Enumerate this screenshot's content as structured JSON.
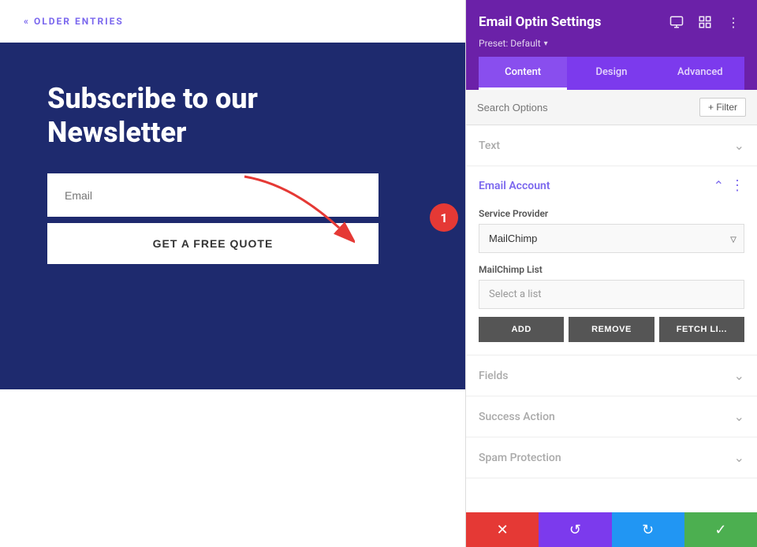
{
  "main": {
    "older_entries_label": "« Older Entries",
    "newsletter_title_line1": "Subscribe to our",
    "newsletter_title_line2": "Newsletter",
    "email_placeholder": "Email",
    "submit_button_label": "Get a free quote"
  },
  "panel": {
    "title": "Email Optin Settings",
    "preset_label": "Preset: Default",
    "tabs": [
      {
        "id": "content",
        "label": "Content",
        "active": true
      },
      {
        "id": "design",
        "label": "Design",
        "active": false
      },
      {
        "id": "advanced",
        "label": "Advanced",
        "active": false
      }
    ],
    "search_placeholder": "Search Options",
    "filter_label": "+ Filter",
    "sections": [
      {
        "id": "text",
        "label": "Text",
        "expanded": false
      },
      {
        "id": "email-account",
        "label": "Email Account",
        "expanded": true
      },
      {
        "id": "fields",
        "label": "Fields",
        "expanded": false
      },
      {
        "id": "success-action",
        "label": "Success Action",
        "expanded": false
      },
      {
        "id": "spam-protection",
        "label": "Spam Protection",
        "expanded": false
      }
    ],
    "email_account": {
      "service_provider_label": "Service Provider",
      "service_provider_value": "MailChimp",
      "mailchimp_list_label": "MailChimp List",
      "select_list_placeholder": "Select a list",
      "btn_add": "ADD",
      "btn_remove": "REMOVE",
      "btn_fetch": "FETCH LI..."
    },
    "footer": {
      "cancel_icon": "✕",
      "undo_icon": "↺",
      "redo_icon": "↻",
      "save_icon": "✓"
    }
  },
  "badge": {
    "number": "1"
  }
}
